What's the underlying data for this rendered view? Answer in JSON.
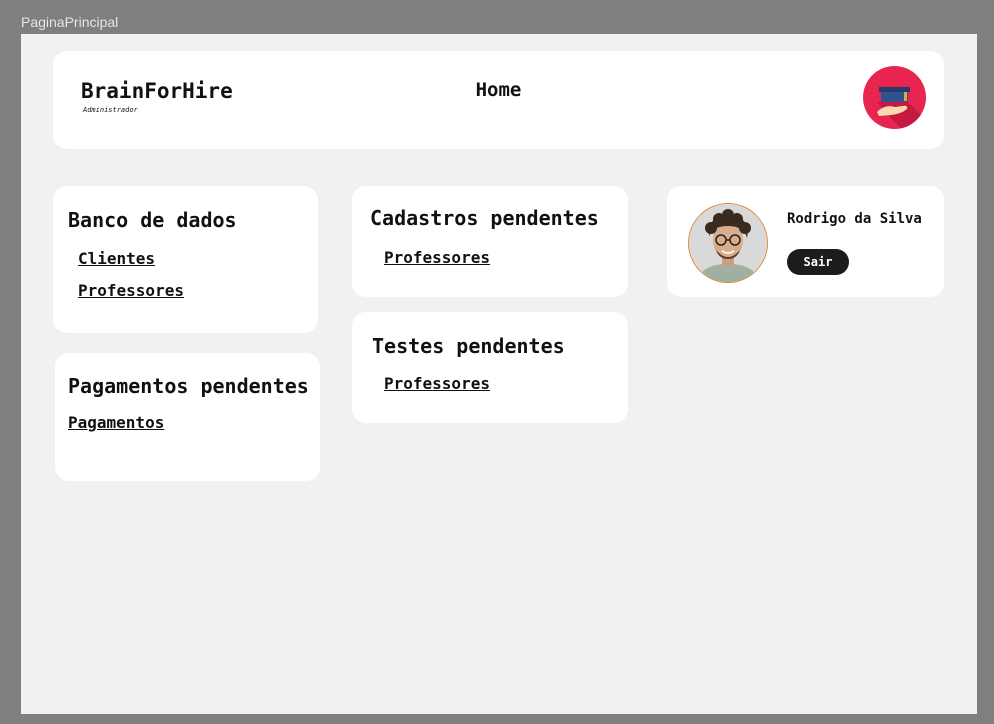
{
  "frame": {
    "label": "PaginaPrincipal"
  },
  "header": {
    "brand": "BrainForHire",
    "role": "Administrador",
    "title": "Home",
    "logo_icon": "hand-holding-graduation-cap-icon",
    "logo_color": "#e8254e"
  },
  "banco": {
    "title": "Banco de dados",
    "links": [
      "Clientes",
      "Professores"
    ]
  },
  "cadastros": {
    "title": "Cadastros pendentes",
    "links": [
      "Professores"
    ]
  },
  "testes": {
    "title": "Testes pendentes",
    "links": [
      "Professores"
    ]
  },
  "pagamentos": {
    "title": "Pagamentos pendentes",
    "links": [
      "Pagamentos"
    ]
  },
  "user": {
    "name": "Rodrigo da Silva",
    "logout_label": "Sair",
    "avatar_icon": "user-photo"
  }
}
